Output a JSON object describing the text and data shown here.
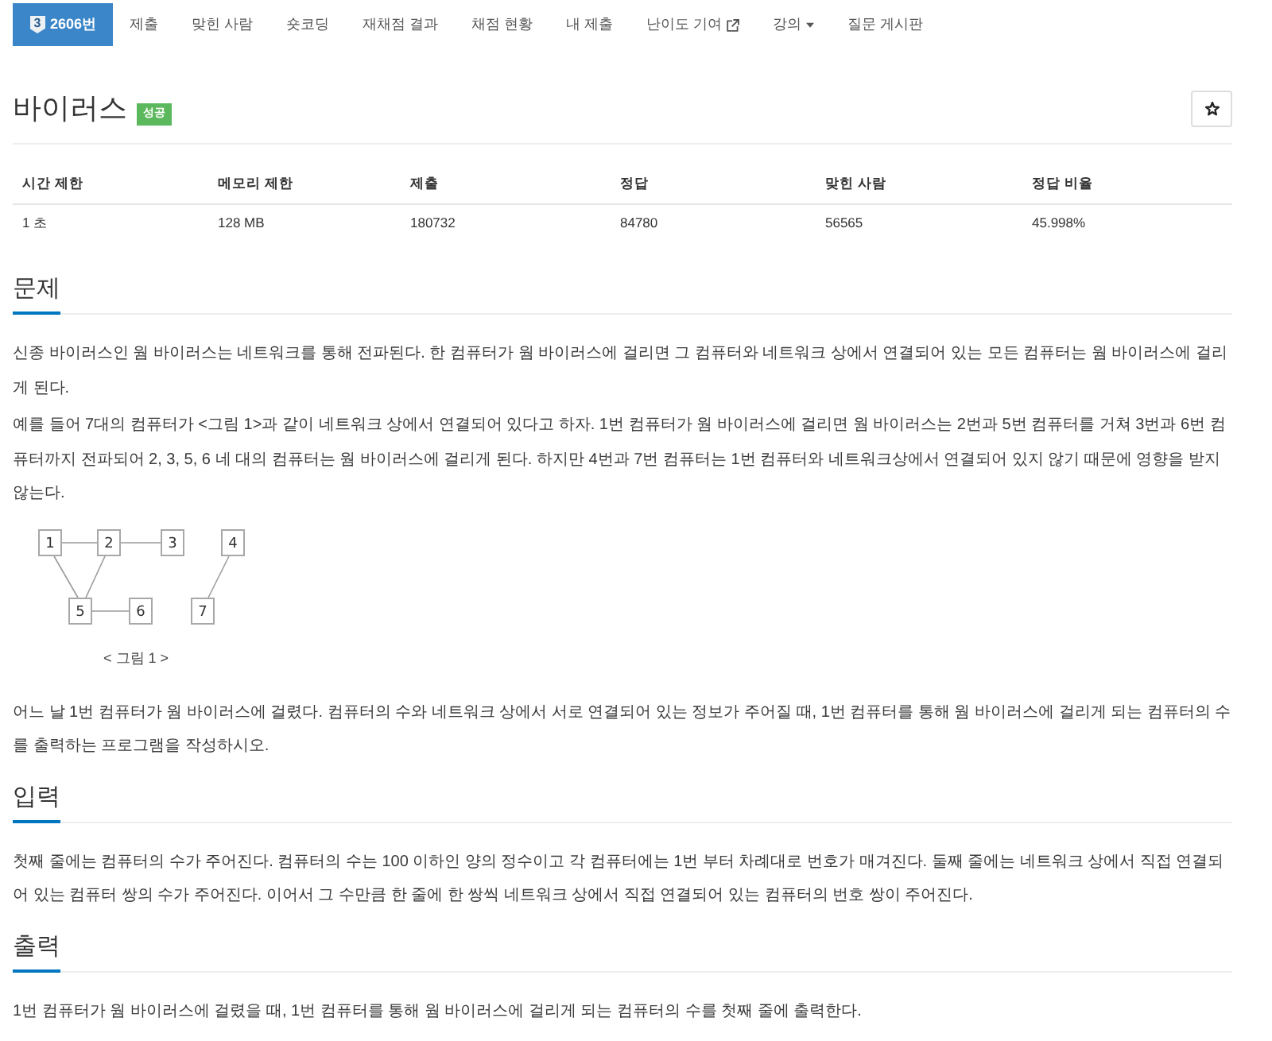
{
  "nav": {
    "tabs": [
      {
        "label": "2606번",
        "badge": "3",
        "kind": "plain",
        "selected": true
      },
      {
        "label": "제출",
        "kind": "plain",
        "selected": false
      },
      {
        "label": "맞힌 사람",
        "kind": "plain",
        "selected": false
      },
      {
        "label": "숏코딩",
        "kind": "plain",
        "selected": false
      },
      {
        "label": "재채점 결과",
        "kind": "plain",
        "selected": false
      },
      {
        "label": "채점 현황",
        "kind": "plain",
        "selected": false
      },
      {
        "label": "내 제출",
        "kind": "plain",
        "selected": false
      },
      {
        "label": "난이도 기여",
        "kind": "external",
        "selected": false
      },
      {
        "label": "강의",
        "kind": "dropdown",
        "selected": false
      },
      {
        "label": "질문 게시판",
        "kind": "plain",
        "selected": false
      }
    ]
  },
  "problem": {
    "title": "바이러스",
    "status_label": "성공"
  },
  "limits_table": {
    "columns": [
      "시간 제한",
      "메모리 제한",
      "제출",
      "정답",
      "맞힌 사람",
      "정답 비율"
    ],
    "rows": [
      [
        "1 초",
        "128 MB",
        "180732",
        "84780",
        "56565",
        "45.998%"
      ]
    ]
  },
  "sections": [
    {
      "heading": "문제",
      "blocks": [
        {
          "kind": "paragraph",
          "text": "신종 바이러스인 웜 바이러스는 네트워크를 통해 전파된다. 한 컴퓨터가 웜 바이러스에 걸리면 그 컴퓨터와 네트워크 상에서 연결되어 있는 모든 컴퓨터는 웜 바이러스에 걸리게 된다."
        },
        {
          "kind": "paragraph",
          "text": "예를 들어 7대의 컴퓨터가 <그림 1>과 같이 네트워크 상에서 연결되어 있다고 하자. 1번 컴퓨터가 웜 바이러스에 걸리면 웜 바이러스는 2번과 5번 컴퓨터를 거쳐 3번과 6번 컴퓨터까지 전파되어 2, 3, 5, 6 네 대의 컴퓨터는 웜 바이러스에 걸리게 된다. 하지만 4번과 7번 컴퓨터는 1번 컴퓨터와 네트워크상에서 연결되어 있지 않기 때문에 영향을 받지 않는다."
        },
        {
          "kind": "figure",
          "nodes": [
            {
              "label": "1"
            },
            {
              "label": "2"
            },
            {
              "label": "3"
            },
            {
              "label": "4"
            },
            {
              "label": "5"
            },
            {
              "label": "6"
            },
            {
              "label": "7"
            }
          ],
          "caption": "< 그림 1 >"
        },
        {
          "kind": "paragraph",
          "text": "어느 날 1번 컴퓨터가 웜 바이러스에 걸렸다. 컴퓨터의 수와 네트워크 상에서 서로 연결되어 있는 정보가 주어질 때, 1번 컴퓨터를 통해 웜 바이러스에 걸리게 되는 컴퓨터의 수를 출력하는 프로그램을 작성하시오."
        }
      ]
    },
    {
      "heading": "입력",
      "blocks": [
        {
          "kind": "paragraph",
          "text": "첫째 줄에는 컴퓨터의 수가 주어진다. 컴퓨터의 수는 100 이하인 양의 정수이고 각 컴퓨터에는 1번 부터 차례대로 번호가 매겨진다. 둘째 줄에는 네트워크 상에서 직접 연결되어 있는 컴퓨터 쌍의 수가 주어진다. 이어서 그 수만큼 한 줄에 한 쌍씩 네트워크 상에서 직접 연결되어 있는 컴퓨터의 번호 쌍이 주어진다."
        }
      ]
    },
    {
      "heading": "출력",
      "blocks": [
        {
          "kind": "paragraph",
          "text": "1번 컴퓨터가 웜 바이러스에 걸렸을 때, 1번 컴퓨터를 통해 웜 바이러스에 걸리게 되는 컴퓨터의 수를 첫째 줄에 출력한다."
        }
      ]
    }
  ]
}
